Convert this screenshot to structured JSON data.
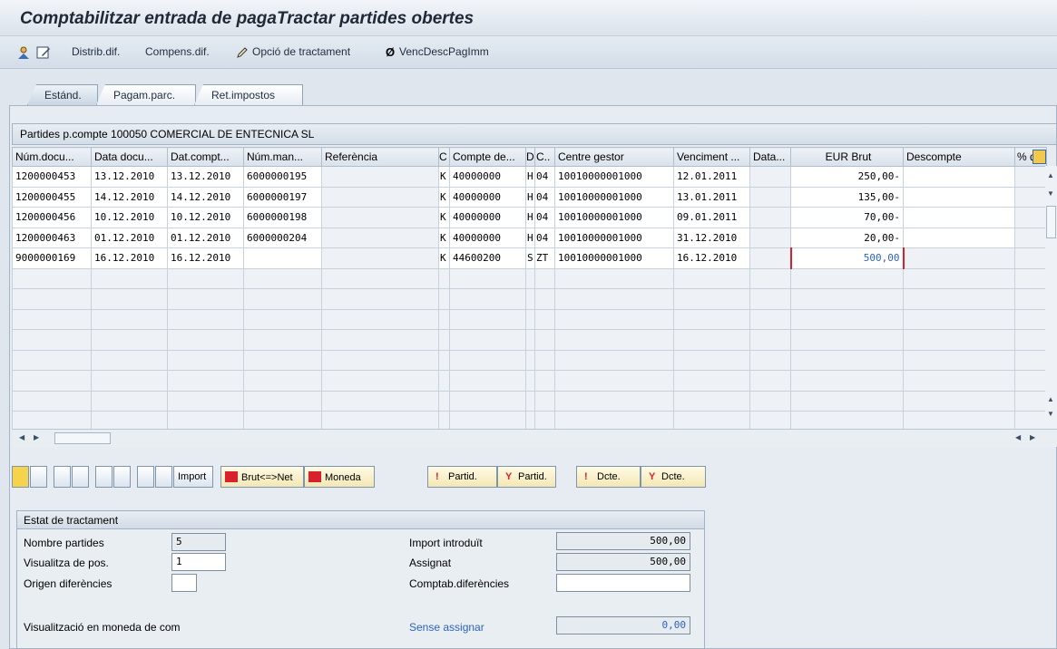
{
  "window": {
    "title": "Comptabilitzar entrada de pagaTractar partides obertes"
  },
  "appbar": {
    "distrib_label": "Distrib.dif.",
    "compens_label": "Compens.dif.",
    "opcio_label": "Opció de tractament",
    "venc_label": "VencDescPagImm"
  },
  "tabs": [
    {
      "label": "Estánd."
    },
    {
      "label": "Pagam.parc."
    },
    {
      "label": "Ret.impostos"
    }
  ],
  "grid": {
    "title": "Partides p.compte 100050 COMERCIAL DE ENTECNICA SL",
    "columns": [
      "Núm.docu...",
      "Data docu...",
      "Dat.compt...",
      "Núm.man...",
      "Referència",
      "C",
      "Compte de...",
      "D",
      "C..",
      "Centre gestor",
      "Venciment ...",
      "Data...",
      "EUR Brut",
      "Descompte",
      "% d"
    ],
    "rows": [
      {
        "doc": "1200000453",
        "data": "13.12.2010",
        "dcompt": "13.12.2010",
        "man": "6000000195",
        "ref": "",
        "c": "K",
        "compte": "40000000",
        "d": "H",
        "cc": "04",
        "centre": "10010000001000",
        "venc": "12.01.2011",
        "data2": "",
        "brut": "250,00-",
        "desc": ""
      },
      {
        "doc": "1200000455",
        "data": "14.12.2010",
        "dcompt": "14.12.2010",
        "man": "6000000197",
        "ref": "",
        "c": "K",
        "compte": "40000000",
        "d": "H",
        "cc": "04",
        "centre": "10010000001000",
        "venc": "13.01.2011",
        "data2": "",
        "brut": "135,00-",
        "desc": ""
      },
      {
        "doc": "1200000456",
        "data": "10.12.2010",
        "dcompt": "10.12.2010",
        "man": "6000000198",
        "ref": "",
        "c": "K",
        "compte": "40000000",
        "d": "H",
        "cc": "04",
        "centre": "10010000001000",
        "venc": "09.01.2011",
        "data2": "",
        "brut": "70,00-",
        "desc": ""
      },
      {
        "doc": "1200000463",
        "data": "01.12.2010",
        "dcompt": "01.12.2010",
        "man": "6000000204",
        "ref": "",
        "c": "K",
        "compte": "40000000",
        "d": "H",
        "cc": "04",
        "centre": "10010000001000",
        "venc": "31.12.2010",
        "data2": "",
        "brut": "20,00-",
        "desc": ""
      },
      {
        "doc": "9000000169",
        "data": "16.12.2010",
        "dcompt": "16.12.2010",
        "man": "",
        "ref": "",
        "c": "K",
        "compte": "44600200",
        "d": "S",
        "cc": "ZT",
        "centre": "10010000001000",
        "venc": "16.12.2010",
        "data2": "",
        "brut": "500,00",
        "desc": ""
      }
    ]
  },
  "toolbar2": {
    "import_label": "Import",
    "brutnet_label": "Brut<=>Net",
    "moneda_label": "Moneda",
    "partid1_label": "Partid.",
    "partid2_label": "Partid.",
    "dcte1_label": "Dcte.",
    "dcte2_label": "Dcte."
  },
  "status": {
    "header": "Estat de tractament",
    "nombre_label": "Nombre partides",
    "nombre_value": "5",
    "visualitza_label": "Visualitza de pos.",
    "visualitza_value": "1",
    "origen_label": "Origen diferències",
    "origen_value": "",
    "visual_moneda_label": "Visualització en moneda de com",
    "import_label": "Import introduït",
    "import_value": "500,00",
    "assignat_label": "Assignat",
    "assignat_value": "500,00",
    "comptab_label": "Comptab.diferències",
    "comptab_value": "",
    "sense_label": "Sense assignar",
    "sense_value": "0,00"
  },
  "colors": {
    "accent_blue": "#2c63c0",
    "red_marker": "#d8212a"
  }
}
